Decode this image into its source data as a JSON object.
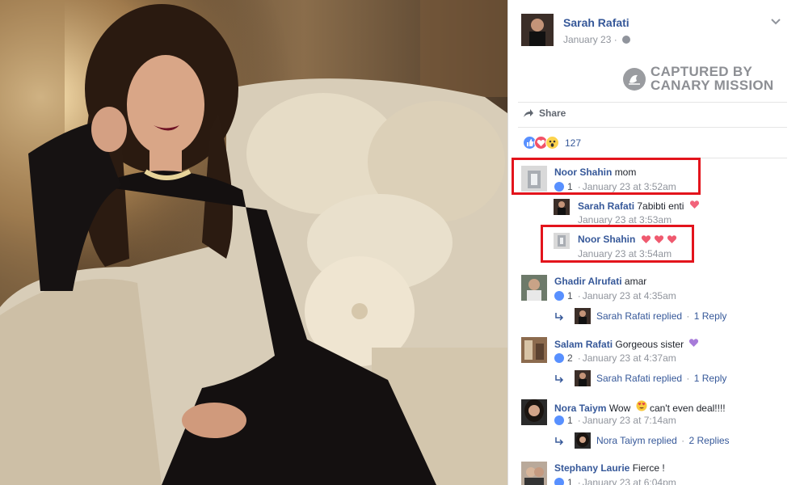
{
  "post": {
    "author": "Sarah Rafati",
    "date": "January 23",
    "privacy_icon": "globe-icon",
    "menu_icon": "chevron-down-icon"
  },
  "watermark": {
    "line1": "CAPTURED BY",
    "line2": "CANARY MISSION"
  },
  "actions": {
    "share_label": "Share"
  },
  "reactions": {
    "types": [
      "like",
      "love",
      "wow"
    ],
    "count": "127"
  },
  "comments": [
    {
      "name": "Noor Shahin",
      "text": "mom",
      "likes": "1",
      "time": "January 23 at 3:52am",
      "highlighted": true,
      "replies": [
        {
          "name": "Sarah Rafati",
          "text": "7abibti enti",
          "emoji": "heart",
          "time": "January 23 at 3:53am"
        },
        {
          "name": "Noor Shahin",
          "text": "",
          "emoji": "three-hearts",
          "time": "January 23 at 3:54am",
          "highlighted": true
        }
      ]
    },
    {
      "name": "Ghadir Alrufati",
      "text": "amar",
      "likes": "1",
      "time": "January 23 at 4:35am",
      "reply_summary": {
        "who": "Sarah Rafati replied",
        "count": "1 Reply"
      }
    },
    {
      "name": "Salam Rafati",
      "text": "Gorgeous sister",
      "emoji": "purple-heart",
      "likes": "2",
      "time": "January 23 at 4:37am",
      "reply_summary": {
        "who": "Sarah Rafati replied",
        "count": "1 Reply"
      }
    },
    {
      "name": "Nora Taiym",
      "text_before": "Wow",
      "emoji": "heart-eyes",
      "text": "can't even deal!!!!",
      "likes": "1",
      "time": "January 23 at 7:14am",
      "reply_summary": {
        "who": "Nora Taiym replied",
        "count": "2 Replies"
      }
    },
    {
      "name": "Stephany Laurie",
      "text": "Fierce !",
      "likes": "1",
      "time": "January 23 at 6:04pm"
    }
  ],
  "colors": {
    "link_blue": "#365899",
    "meta_gray": "#90949c",
    "highlight_red": "#e3141c",
    "like_blue": "#5890ff",
    "love_red": "#f25268"
  }
}
